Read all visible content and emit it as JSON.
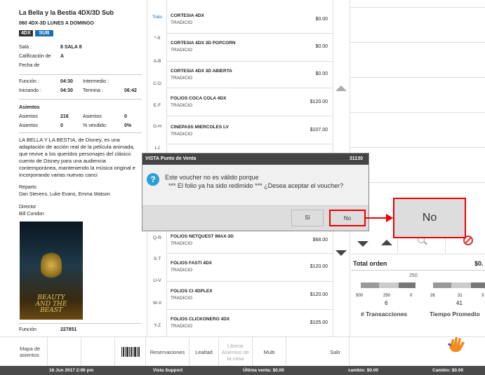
{
  "movie": {
    "title": "La Bella y la Bestia 4DX/3D Sub",
    "schedule": "060 4DX-3D LUNES A DOMINGO",
    "badge_format": "4DX",
    "badge_lang": "SUB",
    "sala_label": "Sala :",
    "sala_value": "8  SALA 8",
    "calificacion_label": "Calificación de",
    "calificacion_value": "A",
    "fecha_label": "Fecha de",
    "funcion_label": "Función :",
    "funcion_value": "04:30",
    "intermedio_label": "Intermedio :",
    "iniciando_label": "Iniciando :",
    "iniciando_value": "04:30",
    "termina_label": "Termina :",
    "termina_value": "06:42",
    "asientos_header": "Asientos",
    "asientos1_label": "Asientos",
    "asientos1_value": "216",
    "asientos2_label": "Asientos",
    "asientos2_value": "0",
    "asientos3_label": "Asientos",
    "asientos3_value": "0",
    "vendido_label": "% vendido:",
    "vendido_value": "0%",
    "description": "LA BELLA Y LA BESTIA, de Disney, es una adaptación de acción real de la película animada, que revive a los queridos personajes del clásico cuento de Disney para una audiencia contemporánea, manteniendo la música original e incorporando varias nuevas canci",
    "reparto_label": "Reparto",
    "reparto_value": "Dan Stevens, Luke Evans, Emma Watson",
    "director_label": "Director",
    "director_value": "Bill Condon",
    "poster_text": "BEAUTY AND THE BEAST",
    "funcion_bottom_label": "Función",
    "funcion_bottom_value": "227851"
  },
  "categories": [
    "Todo",
    "*-9",
    "A-B",
    "C-D",
    "E-F",
    "G-H",
    "I-J",
    "K-L",
    "M-N",
    "O-P",
    "Q-R",
    "S-T",
    "U-V",
    "W-X",
    "Y-Z"
  ],
  "products_top": [
    {
      "name": "CORTESIA 4DX",
      "type": "TRADICIO",
      "price": "$0.00"
    },
    {
      "name": "CORTESIA 4DX 3D POPCORN",
      "type": "TRADICIO",
      "price": "$0.00"
    },
    {
      "name": "CORTESIA 4DX 3D ABIERTA",
      "type": "TRADICIO",
      "price": "$0.00"
    },
    {
      "name": "FOLIOS COCA COLA 4DX",
      "type": "TRADICIO",
      "price": "$120.00"
    },
    {
      "name": "CINEPASS MIERCOLES LV",
      "type": "TRADICIO",
      "price": "$107.00"
    }
  ],
  "products_bottom": [
    {
      "name": "FOLIOS NETQUEST IMAX-3D",
      "type": "TRADICIO",
      "price": "$68.00"
    },
    {
      "name": "FOLIOS FASTI 4DX",
      "type": "TRADICIO",
      "price": "$120.00"
    },
    {
      "name": "FOLIOS CI 4DPLEX",
      "type": "TRADICIO",
      "price": "$120.00"
    },
    {
      "name": "FOLIOS CLICKONERO 4DX",
      "type": "TRADICIO",
      "price": "$105.00"
    }
  ],
  "dialog": {
    "title": "VISTA Punto de Venta",
    "code": "31130",
    "line1": "Este voucher no es válido porque",
    "line2": "*** El folio ya ha sido redimido *** ¿Desea aceptar  el voucher?",
    "yes_label": "Sí",
    "no_label": "No",
    "callout_label": "No"
  },
  "totals": {
    "title": "Total orden",
    "value": "$0.",
    "left_marker": "250",
    "left_scale": [
      "500",
      "250",
      "0"
    ],
    "left_value": "6",
    "left_caption": "# Transacciones",
    "right_scale": [
      "26",
      "31",
      "3"
    ],
    "right_value": "41",
    "right_caption": "Tiempo Promedio"
  },
  "bottom_buttons": {
    "mapa": "Mapa de asientos",
    "reservaciones": "Reservaciones",
    "lealtad": "Lealtad",
    "liberar": "Liberar Asientos de la casa",
    "multi": "Multi",
    "salir": "Salir"
  },
  "status": {
    "datetime": "16 Jun 2017 2:06 pm",
    "support": "Vista Support",
    "ultima": "Última venta: $0.00",
    "cambio1": "cambio: $0.00",
    "cambio2": "Cambio: $0.00"
  },
  "colors": {
    "accent": "#1a6fb5",
    "highlight": "#e00000",
    "status_bar": "#4a4a4a",
    "help_icon": "#2a9fd6"
  }
}
